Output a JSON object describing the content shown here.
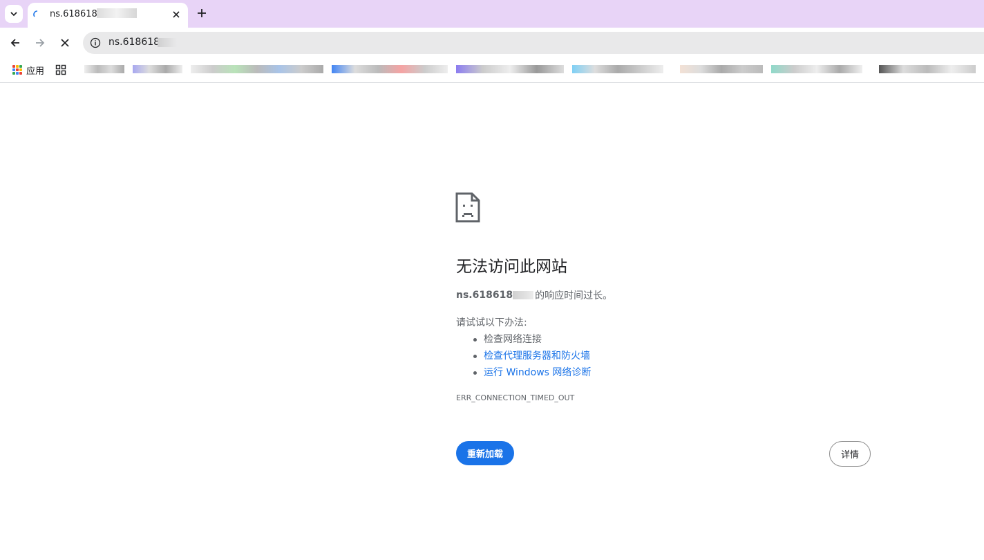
{
  "tab": {
    "title": "ns.618618..",
    "favicon": "loading-spinner-icon",
    "close_icon": "close-icon"
  },
  "toolbar": {
    "url": "ns.618618..",
    "back_icon": "back-arrow-icon",
    "forward_icon": "forward-arrow-icon",
    "stop_icon": "stop-icon"
  },
  "bookmarks": {
    "apps_label": "应用"
  },
  "error": {
    "title": "无法访问此网站",
    "host": "ns.618618",
    "message": "的响应时间过长。",
    "try_label": "请试试以下办法:",
    "suggestions": {
      "check_network": "检查网络连接",
      "check_proxy": "检查代理服务器和防火墙",
      "run_diagnostics": "运行 Windows 网络诊断"
    },
    "code": "ERR_CONNECTION_TIMED_OUT"
  },
  "buttons": {
    "reload": "重新加载",
    "details": "详情"
  },
  "colors": {
    "tabstrip": "#e8d4f7",
    "link": "#1a73e8",
    "primary_button": "#1a73e8"
  }
}
